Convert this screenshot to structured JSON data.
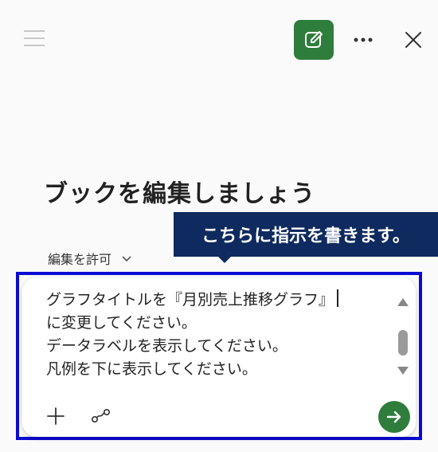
{
  "header": {
    "menu_icon": "hamburger-menu-icon",
    "edit_icon": "edit-square-icon",
    "more_icon": "more-horizontal-icon",
    "close_icon": "close-icon",
    "edit_button_color": "#2e7d3c"
  },
  "main": {
    "title": "ブックを編集しましょう",
    "permission_label": "編集を許可",
    "permission_icon": "chevron-down-icon"
  },
  "annotation": {
    "callout_text": "こちらに指示を書きます。",
    "callout_color": "#0e2a5e",
    "frame_color": "#0a0ad2"
  },
  "composer": {
    "lines": [
      "グラフタイトルを『月別売上推移グラフ』",
      "に変更してください。",
      "データラベルを表示してください。",
      "凡例を下に表示してください。"
    ],
    "add_icon": "plus-icon",
    "link_icon": "link-icon",
    "send_icon": "arrow-right-icon",
    "send_color": "#2e7d3c"
  }
}
